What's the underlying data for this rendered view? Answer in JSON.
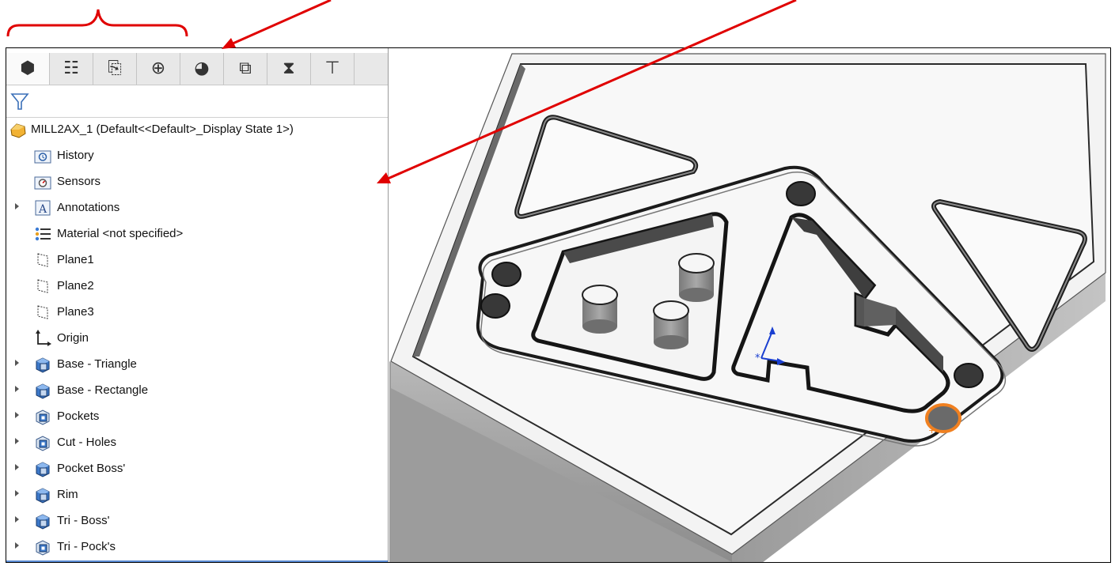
{
  "toolbar": {
    "tabs": [
      {
        "icon": "part-icon",
        "glyph": "⬢"
      },
      {
        "icon": "property-manager-icon",
        "glyph": "☷"
      },
      {
        "icon": "configuration-manager-icon",
        "glyph": "⎘"
      },
      {
        "icon": "dimxpert-icon",
        "glyph": "⊕"
      },
      {
        "icon": "display-manager-icon",
        "glyph": "◕"
      },
      {
        "icon": "cam-feature-tree-icon",
        "glyph": "⧉"
      },
      {
        "icon": "cam-operation-tree-icon",
        "glyph": "⧗"
      },
      {
        "icon": "cam-tool-tree-icon",
        "glyph": "⊤"
      }
    ],
    "active_tab": 0
  },
  "filter": {
    "icon": "filter-icon"
  },
  "tree": {
    "root": "MILL2AX_1  (Default<<Default>_Display State 1>)",
    "items": [
      {
        "label": "History",
        "icon": "history-folder-icon",
        "expandable": false
      },
      {
        "label": "Sensors",
        "icon": "sensors-folder-icon",
        "expandable": false
      },
      {
        "label": "Annotations",
        "icon": "annotations-icon",
        "expandable": true
      },
      {
        "label": "Material <not specified>",
        "icon": "material-icon",
        "expandable": false
      },
      {
        "label": "Plane1",
        "icon": "plane-icon",
        "expandable": false
      },
      {
        "label": "Plane2",
        "icon": "plane-icon",
        "expandable": false
      },
      {
        "label": "Plane3",
        "icon": "plane-icon",
        "expandable": false
      },
      {
        "label": "Origin",
        "icon": "origin-icon",
        "expandable": false
      },
      {
        "label": "Base - Triangle",
        "icon": "boss-extrude-icon",
        "expandable": true
      },
      {
        "label": "Base - Rectangle",
        "icon": "boss-extrude-icon",
        "expandable": true
      },
      {
        "label": "Pockets",
        "icon": "cut-extrude-icon",
        "expandable": true
      },
      {
        "label": "Cut - Holes",
        "icon": "cut-extrude-icon",
        "expandable": true
      },
      {
        "label": "Pocket Boss'",
        "icon": "boss-extrude-icon",
        "expandable": true
      },
      {
        "label": "Rim",
        "icon": "boss-extrude-icon",
        "expandable": true
      },
      {
        "label": "Tri - Boss'",
        "icon": "boss-extrude-icon",
        "expandable": true
      },
      {
        "label": "Tri - Pock's",
        "icon": "cut-extrude-icon",
        "expandable": true
      }
    ]
  },
  "colors": {
    "annotation": "#e00000",
    "highlight": "#f08020",
    "part_gray": "#a8a8a8",
    "accent": "#5b8dd6"
  }
}
